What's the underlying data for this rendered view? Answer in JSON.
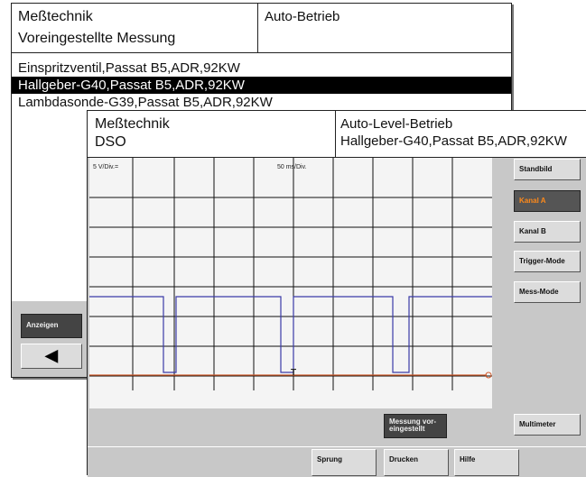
{
  "back_window": {
    "header_left_line1": "Meßtechnik",
    "header_left_line2": "Voreingestellte Messung",
    "header_right": "Auto-Betrieb",
    "list_items": [
      "Einspritzventil,Passat B5,ADR,92KW",
      "Hallgeber-G40,Passat B5,ADR,92KW",
      "Lambdasonde-G39,Passat B5,ADR,92KW"
    ],
    "selected_index": 1,
    "show_button": "Anzeigen",
    "back_arrow": "◀"
  },
  "front_window": {
    "header_left_line1": "Meßtechnik",
    "header_left_line2": "DSO",
    "header_right_line1": "Auto-Level-Betrieb",
    "header_right_line2": "Hallgeber-G40,Passat B5,ADR,92KW",
    "scope": {
      "volts_per_div": "5 V/Div.=",
      "time_per_div": "50 ms/Div.",
      "trigger_marker": "T"
    },
    "side_buttons": [
      "Standbild",
      "Kanal A",
      "Kanal B",
      "Trigger-Mode",
      "Mess-Mode"
    ],
    "active_side_button": "Kanal A",
    "measure_preset_button_line1": "Messung vor-",
    "measure_preset_button_line2": "eingestellt",
    "multimeter_button": "Multimeter",
    "bottom_buttons": [
      "Sprung",
      "Drucken",
      "Hilfe"
    ],
    "colors": {
      "trace_a": "#3a3aa8",
      "trace_b": "#d05a2a",
      "grid": "#111111"
    }
  }
}
